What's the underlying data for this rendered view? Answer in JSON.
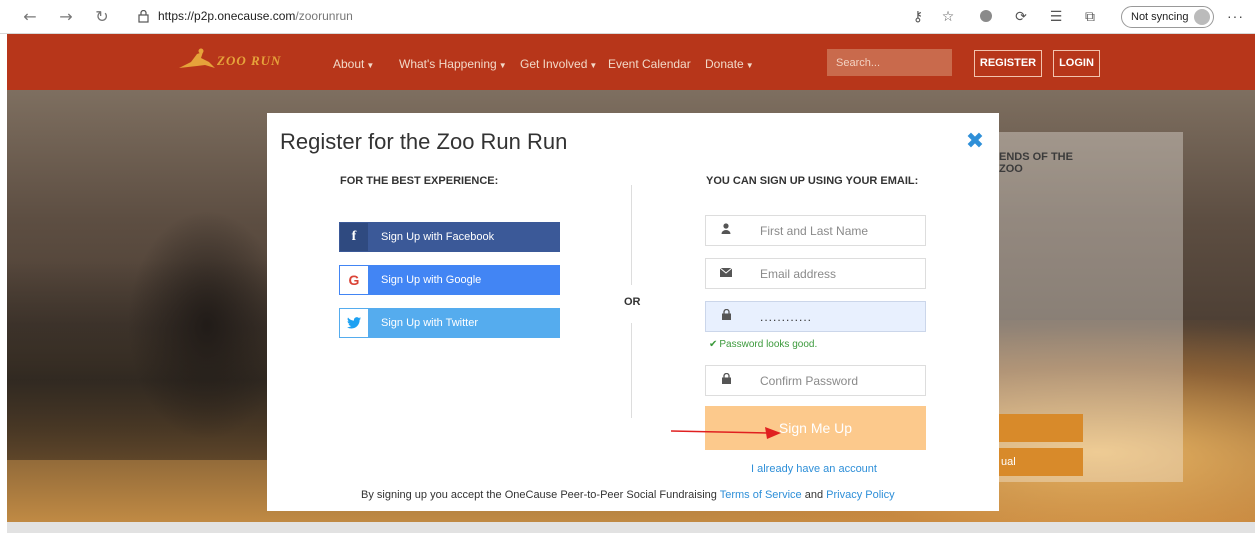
{
  "browser": {
    "back_icon": "back-arrow-icon",
    "forward_icon": "forward-arrow-icon",
    "reload_icon": "reload-icon",
    "url_host": "https://p2p.onecause.com",
    "url_path": "/zoorunrun",
    "sync_label": "Not syncing",
    "more_label": "···"
  },
  "site": {
    "logo_text": "ZOO RUN",
    "nav": [
      {
        "label": "About"
      },
      {
        "label": "What's Happening"
      },
      {
        "label": "Get Involved"
      },
      {
        "label": "Event Calendar"
      },
      {
        "label": "Donate"
      }
    ],
    "search_placeholder": "Search...",
    "register_label": "REGISTER",
    "login_label": "LOGIN",
    "card_text_line1": "ENDS OF THE",
    "card_text_line2": "ZOO",
    "card_btn2_text": "ual",
    "header_color": "#b7361a"
  },
  "modal": {
    "title": "Register for the Zoo Run Run",
    "close_symbol": "✖",
    "left_heading": "FOR THE BEST EXPERIENCE:",
    "right_heading": "YOU CAN SIGN UP USING YOUR EMAIL:",
    "or_label": "OR",
    "social": {
      "facebook": {
        "label": "Sign Up with Facebook",
        "icon": "f",
        "color": "#3b5998"
      },
      "google": {
        "label": "Sign Up with Google",
        "icon": "G",
        "color": "#4285f4"
      },
      "twitter": {
        "label": "Sign Up with Twitter",
        "icon": "🐦",
        "color": "#55acee"
      }
    },
    "fields": {
      "name_placeholder": "First and Last Name",
      "email_placeholder": "Email address",
      "password_value": "............",
      "confirm_placeholder": "Confirm Password"
    },
    "password_ok": "Password looks good.",
    "signup_label": "Sign Me Up",
    "signup_color": "#fcc98c",
    "have_account": "I already have an account",
    "terms_prefix": "By signing up you accept the OneCause Peer-to-Peer Social Fundraising",
    "terms_link": "Terms of Service",
    "terms_and": "and",
    "privacy_link": "Privacy Policy",
    "link_color": "#2e8fd8"
  }
}
